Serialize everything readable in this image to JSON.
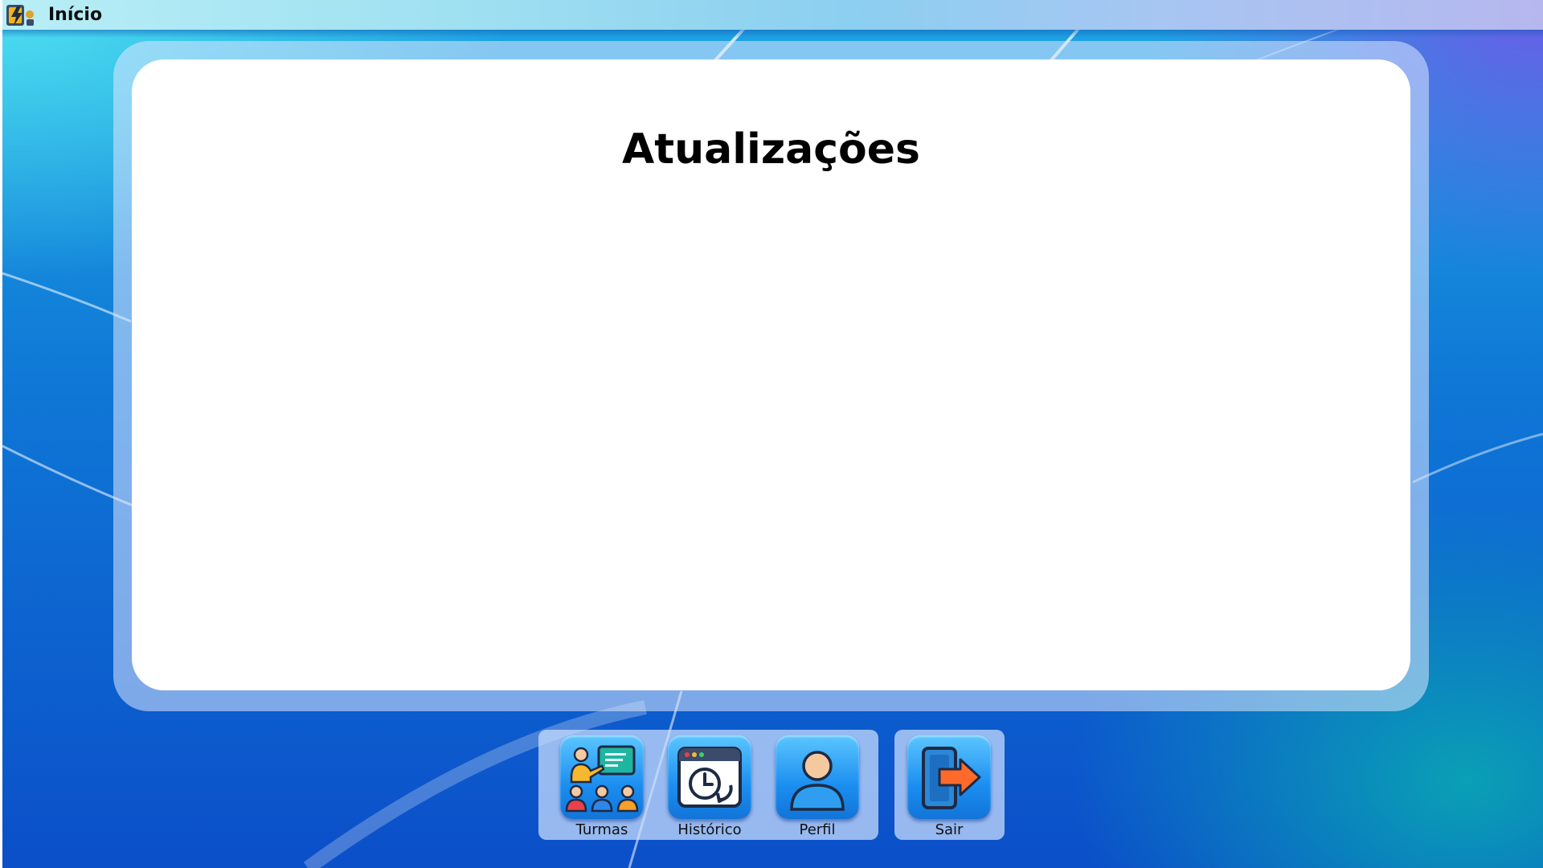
{
  "window": {
    "title": "Início"
  },
  "main": {
    "heading": "Atualizações"
  },
  "dock": {
    "items": [
      {
        "label": "Turmas",
        "icon": "classroom-teacher-icon"
      },
      {
        "label": "Histórico",
        "icon": "history-clock-icon"
      },
      {
        "label": "Perfil",
        "icon": "user-profile-icon"
      }
    ],
    "exit": {
      "label": "Sair",
      "icon": "exit-door-icon"
    }
  },
  "colors": {
    "tile_top": "#5cc6ff",
    "tile_bottom": "#1274d8",
    "exit_arrow": "#ff6a2a",
    "panel_background": "#ffffff"
  }
}
